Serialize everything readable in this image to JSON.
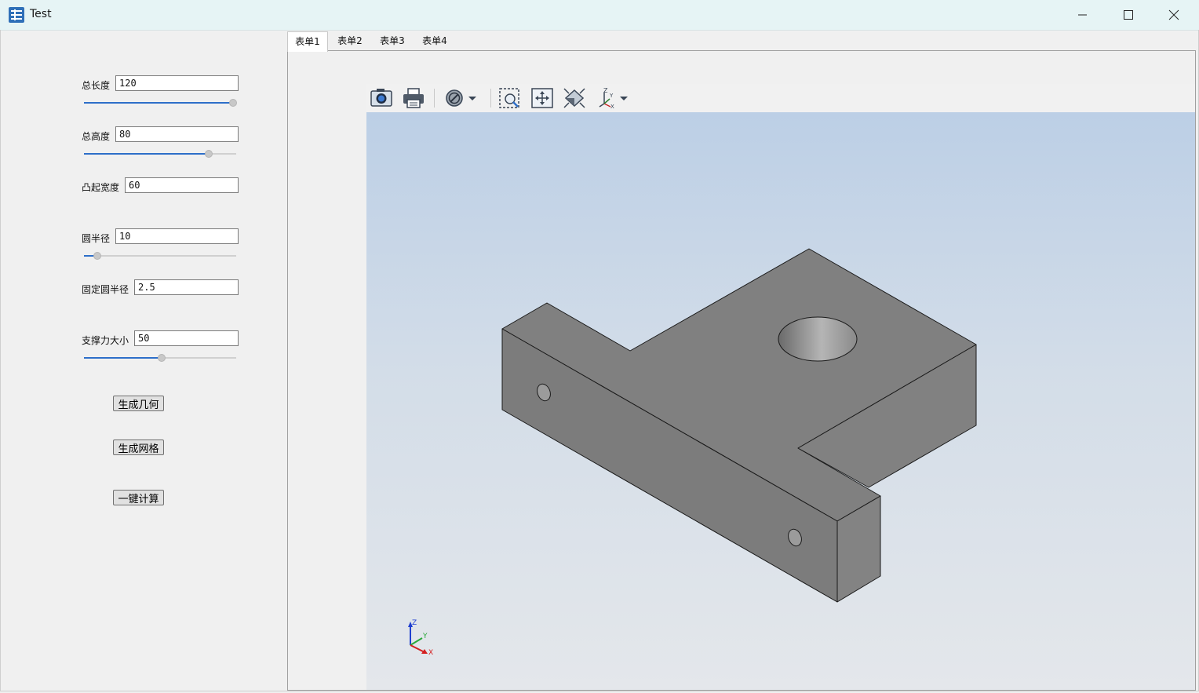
{
  "window": {
    "title": "Test"
  },
  "params": [
    {
      "label": "总长度",
      "value": "120",
      "slider": 0.98
    },
    {
      "label": "总高度",
      "value": "80",
      "slider": 0.82
    },
    {
      "label": "凸起宽度",
      "value": "60"
    },
    {
      "label": "圆半径",
      "value": "10",
      "slider": 0.09
    },
    {
      "label": "固定圆半径",
      "value": "2.5"
    },
    {
      "label": "支撑力大小",
      "value": "50",
      "slider": 0.51
    }
  ],
  "actions": {
    "generate_geometry": "生成几何",
    "generate_mesh": "生成网格",
    "one_click_compute": "一键计算"
  },
  "tabs": [
    "表单1",
    "表单2",
    "表单3",
    "表单4"
  ],
  "active_tab": "表单1",
  "toolbar_icons": [
    "camera-icon",
    "print-icon",
    "display-mode-icon",
    "zoom-window-icon",
    "pan-icon",
    "fit-all-icon",
    "view-axis-icon"
  ],
  "triad": {
    "z": "Z",
    "y": "Y",
    "x": "X"
  },
  "colors": {
    "accent": "#2e6fc9",
    "titlebar": "#e6f4f5",
    "part": "#808080"
  }
}
